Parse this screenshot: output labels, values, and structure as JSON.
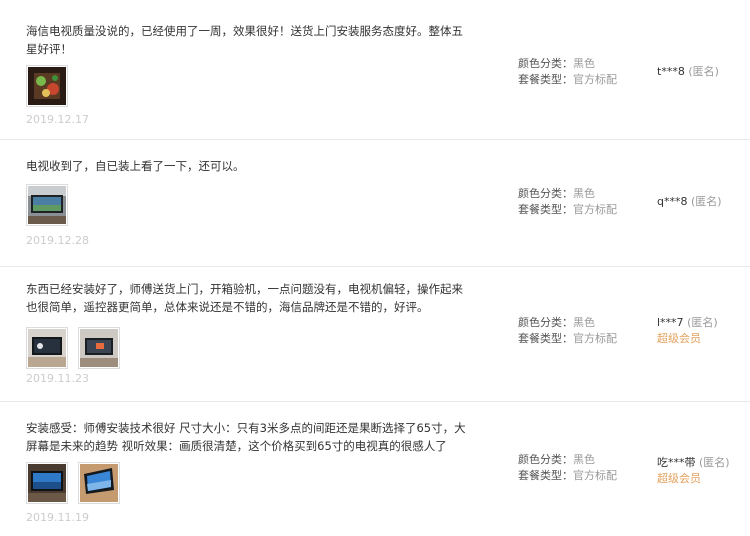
{
  "meta_labels": {
    "color": "颜色分类：",
    "package": "套餐类型："
  },
  "reviews": [
    {
      "text": "海信电视质量没说的，已经使用了一周，效果很好！送货上门安装服务态度好。整体五星好评！",
      "date": "2019.12.17",
      "color_value": "黑色",
      "package_value": "官方标配",
      "user": "t***8",
      "anon": "(匿名)",
      "member": ""
    },
    {
      "text": "电视收到了，自已装上看了一下，还可以。",
      "date": "2019.12.28",
      "color_value": "黑色",
      "package_value": "官方标配",
      "user": "q***8",
      "anon": "(匿名)",
      "member": ""
    },
    {
      "text": "东西已经安装好了，师傅送货上门，开箱验机，一点问题没有，电视机偏轻，操作起来也很简单，遥控器更简单，总体来说还是不错的，海信品牌还是不错的，好评。",
      "date": "2019.11.23",
      "color_value": "黑色",
      "package_value": "官方标配",
      "user": "l***7",
      "anon": "(匿名)",
      "member": "超级会员"
    },
    {
      "text": "安装感受：师傅安装技术很好 尺寸大小：只有3米多点的间距还是果断选择了65寸，大屏幕是未来的趋势 视听效果：画质很清楚，这个价格买到65寸的电视真的很感人了",
      "date": "2019.11.19",
      "color_value": "黑色",
      "package_value": "官方标配",
      "user": "吃***带",
      "anon": "(匿名)",
      "member": "超级会员"
    }
  ]
}
